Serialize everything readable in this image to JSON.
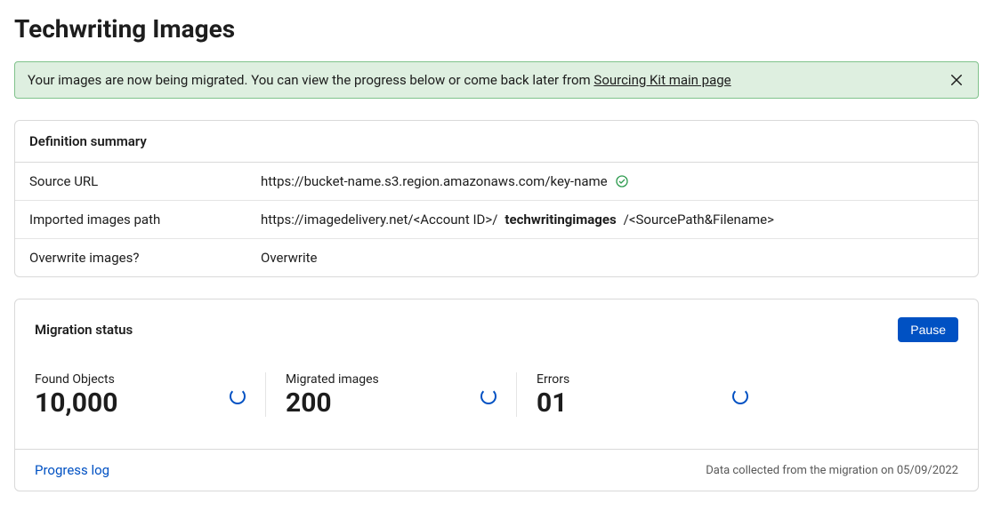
{
  "page": {
    "title": "Techwriting Images"
  },
  "alert": {
    "text_prefix": "Your images are now being migrated. You can view the progress below or come back later from ",
    "link_text": "Sourcing Kit main page"
  },
  "definition": {
    "header": "Definition summary",
    "rows": {
      "source_url": {
        "label": "Source URL",
        "value": "https://bucket-name.s3.region.amazonaws.com/key-name"
      },
      "imported_path": {
        "label": "Imported images path",
        "prefix": "https://imagedelivery.net/<Account ID>/",
        "bold": "techwritingimages",
        "suffix": "/<SourcePath&Filename>"
      },
      "overwrite": {
        "label": "Overwrite images?",
        "value": "Overwrite"
      }
    }
  },
  "status": {
    "header": "Migration status",
    "pause_label": "Pause",
    "stats": {
      "found": {
        "label": "Found Objects",
        "value": "10,000"
      },
      "migrated": {
        "label": "Migrated images",
        "value": "200"
      },
      "errors": {
        "label": "Errors",
        "value": "01"
      }
    },
    "progress_log_label": "Progress log",
    "collected_text": "Data collected from the migration on 05/09/2022"
  }
}
